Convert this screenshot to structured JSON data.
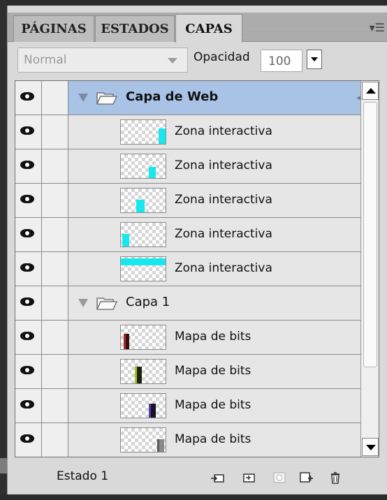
{
  "tabs": [
    {
      "label": "PÁGINAS"
    },
    {
      "label": "ESTADOS"
    },
    {
      "label": "CAPAS"
    }
  ],
  "panel_menu_icon": "panel-menu-icon",
  "options": {
    "blend_mode": "Normal",
    "opacity_label": "Opacidad",
    "opacity_value": "100"
  },
  "layers": [
    {
      "type": "group",
      "name": "Capa de Web",
      "selected": true,
      "icon": "folder-icon",
      "link_icon": "layer-link-icon"
    },
    {
      "type": "item",
      "name": "Zona interactiva",
      "thumb_color": "#18e8ee"
    },
    {
      "type": "item",
      "name": "Zona interactiva",
      "thumb_color": "#18e8ee"
    },
    {
      "type": "item",
      "name": "Zona interactiva",
      "thumb_color": "#18e8ee"
    },
    {
      "type": "item",
      "name": "Zona interactiva",
      "thumb_color": "#18e8ee"
    },
    {
      "type": "item",
      "name": "Zona interactiva",
      "thumb_color": "#18e8ee"
    },
    {
      "type": "group",
      "name": "Capa 1",
      "selected": false,
      "icon": "folder-icon"
    },
    {
      "type": "item",
      "name": "Mapa de bits",
      "thumb_color": "#6a1a1a"
    },
    {
      "type": "item",
      "name": "Mapa de bits",
      "thumb_color": "#4a5a10"
    },
    {
      "type": "item",
      "name": "Mapa de bits",
      "thumb_color": "#3a2a6a"
    },
    {
      "type": "item",
      "name": "Mapa de bits",
      "thumb_color": "#8a8a8a"
    }
  ],
  "footer": {
    "state_label": "Estado 1"
  },
  "colors": {
    "selected_row": "#a9c3e6",
    "hotspot": "#18e8ee",
    "panel_bg": "#d9d9d9"
  }
}
